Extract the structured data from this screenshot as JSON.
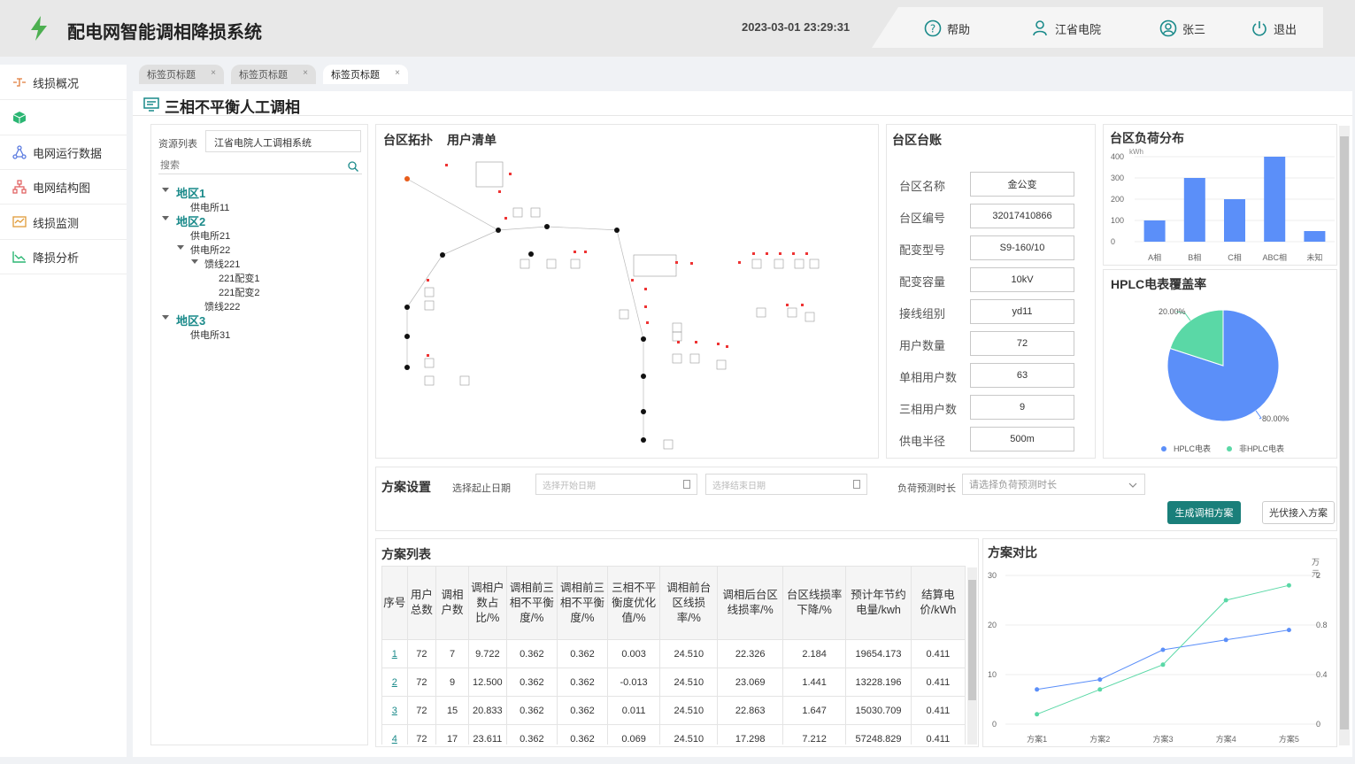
{
  "header": {
    "title": "配电网智能调相降损系统",
    "datetime": "2023-03-01 23:29:31",
    "help": "帮助",
    "org": "江省电院",
    "user": "张三",
    "logout": "退出"
  },
  "sidebar": {
    "items": [
      {
        "label": "线损概况",
        "icon": "line-loss-icon"
      },
      {
        "label": "",
        "icon": "cube-icon"
      },
      {
        "label": "电网运行数据",
        "icon": "network-icon"
      },
      {
        "label": "电网结构图",
        "icon": "structure-icon"
      },
      {
        "label": "线损监测",
        "icon": "monitor-icon"
      },
      {
        "label": "降损分析",
        "icon": "analysis-icon"
      }
    ]
  },
  "tabs": [
    "标签页标题",
    "标签页标题",
    "标签页标题"
  ],
  "page": {
    "title": "三相不平衡人工调相"
  },
  "resource": {
    "label": "资源列表",
    "value": "江省电院人工调相系统",
    "search_placeholder": "搜索",
    "tree": {
      "r1": "地区1",
      "r1_s1": "供电所11",
      "r2": "地区2",
      "r2_s1": "供电所21",
      "r2_s2": "供电所22",
      "r2_l1": "馈线221",
      "r2_t1": "221配变1",
      "r2_t2": "221配变2",
      "r2_l2": "馈线222",
      "r3": "地区3",
      "r3_s1": "供电所31"
    }
  },
  "topology": {
    "title1": "台区拓扑",
    "title2": "用户清单"
  },
  "ledger": {
    "title": "台区台账",
    "rows": [
      {
        "label": "台区名称",
        "value": "金公变"
      },
      {
        "label": "台区编号",
        "value": "32017410866"
      },
      {
        "label": "配变型号",
        "value": "S9-160/10"
      },
      {
        "label": "配变容量",
        "value": "10kV"
      },
      {
        "label": "接线组别",
        "value": "yd11"
      },
      {
        "label": "用户数量",
        "value": "72"
      },
      {
        "label": "单相用户数",
        "value": "63"
      },
      {
        "label": "三相用户数",
        "value": "9"
      },
      {
        "label": "供电半径",
        "value": "500m"
      }
    ]
  },
  "plan": {
    "title": "方案设置",
    "date_label": "选择起止日期",
    "start_placeholder": "选择开始日期",
    "end_placeholder": "选择结束日期",
    "forecast_label": "负荷预测时长",
    "forecast_placeholder": "请选择负荷预测时长",
    "generate_btn": "生成调相方案",
    "pv_btn": "光伏接入方案"
  },
  "scheme_list": {
    "title": "方案列表",
    "columns": [
      "序号",
      "用户总数",
      "调相户数",
      "调相户数占比/%",
      "调相前三相不平衡度/%",
      "调相前三相不平衡度/%",
      "三相不平衡度优化值/%",
      "调相前台区线损率/%",
      "调相后台区线损率/%",
      "台区线损率下降/%",
      "预计年节约电量/kwh",
      "结算电价/kWh"
    ],
    "rows": [
      [
        "1",
        "72",
        "7",
        "9.722",
        "0.362",
        "0.362",
        "0.003",
        "24.510",
        "22.326",
        "2.184",
        "19654.173",
        "0.411"
      ],
      [
        "2",
        "72",
        "9",
        "12.500",
        "0.362",
        "0.362",
        "-0.013",
        "24.510",
        "23.069",
        "1.441",
        "13228.196",
        "0.411"
      ],
      [
        "3",
        "72",
        "15",
        "20.833",
        "0.362",
        "0.362",
        "0.011",
        "24.510",
        "22.863",
        "1.647",
        "15030.709",
        "0.411"
      ],
      [
        "4",
        "72",
        "17",
        "23.611",
        "0.362",
        "0.362",
        "0.069",
        "24.510",
        "17.298",
        "7.212",
        "57248.829",
        "0.411"
      ]
    ]
  },
  "chart_data": [
    {
      "type": "bar",
      "title": "台区负荷分布",
      "ylabel": "kWh",
      "categories": [
        "A相",
        "B相",
        "C相",
        "ABC相",
        "未知"
      ],
      "values": [
        100,
        300,
        200,
        400,
        50
      ],
      "ylim": [
        0,
        400
      ],
      "yticks": [
        "0",
        "100",
        "200",
        "300",
        "400"
      ],
      "color": "#5b8ff9"
    },
    {
      "type": "pie",
      "title": "HPLC电表覆盖率",
      "slices": [
        {
          "label": "HPLC电表",
          "value": 80,
          "text": "80.00%",
          "color": "#5b8ff9"
        },
        {
          "label": "非HPLC电表",
          "value": 20,
          "text": "20.00%",
          "color": "#5ad8a6"
        }
      ],
      "legend": "bottom"
    },
    {
      "type": "line",
      "title": "方案对比",
      "categories": [
        "方案1",
        "方案2",
        "方案3",
        "方案4",
        "方案5"
      ],
      "left_ticks": [
        "0",
        "10",
        "20",
        "30"
      ],
      "right_ticks": [
        "0",
        "0.4",
        "0.8",
        "2"
      ],
      "right_unit": "万元",
      "series": [
        {
          "color": "#5b8ff9",
          "values": [
            7,
            9,
            15,
            17,
            19
          ]
        },
        {
          "color": "#5ad8a6",
          "values": [
            2,
            7,
            12,
            25,
            28
          ]
        }
      ],
      "ylim": [
        0,
        30
      ]
    }
  ],
  "colors": {
    "accent": "#1a8a8a",
    "button": "#1a7f7a",
    "bar": "#5b8ff9",
    "green": "#5ad8a6"
  }
}
